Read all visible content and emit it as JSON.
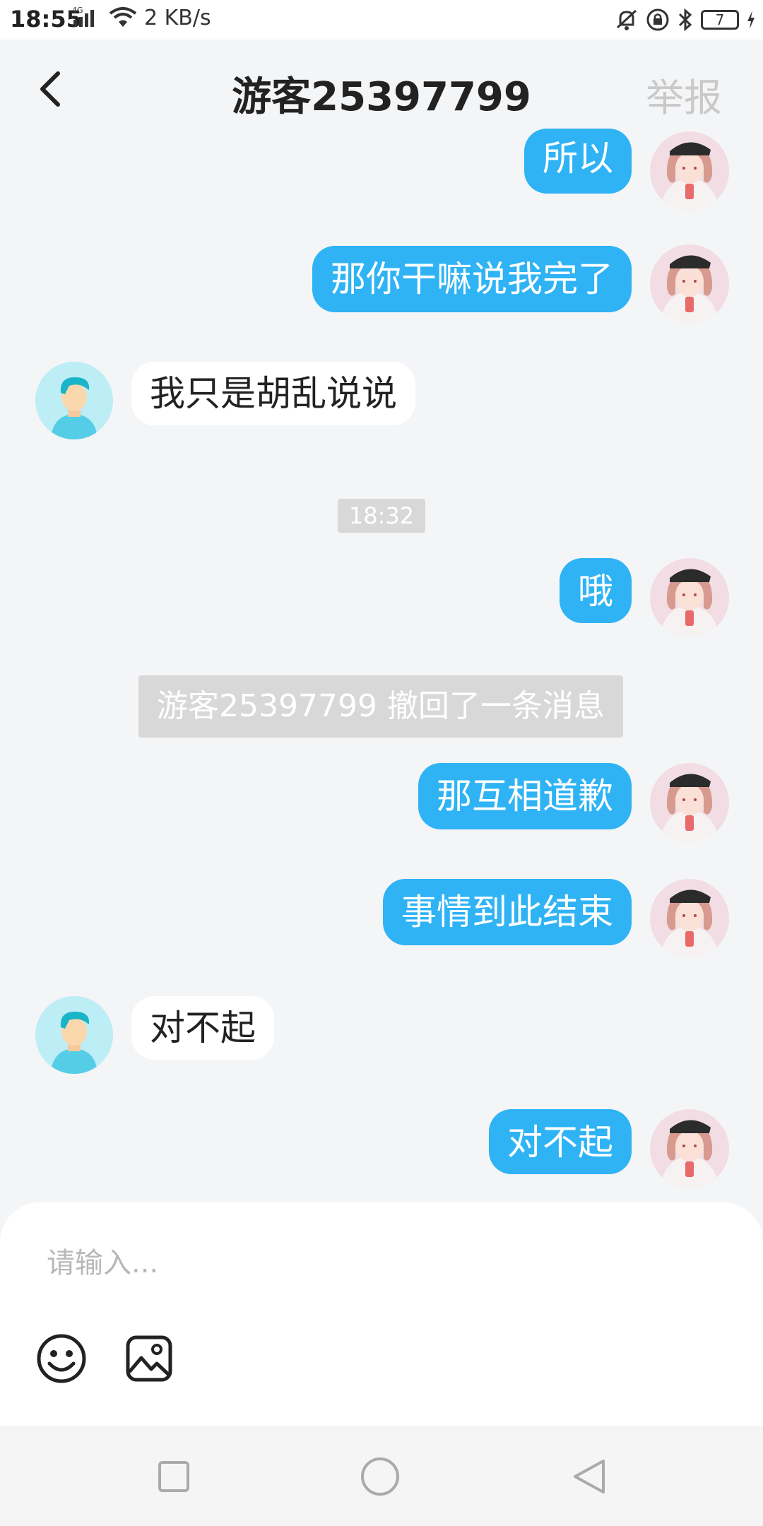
{
  "status_bar": {
    "time": "18:55",
    "network": "4G",
    "speed": "2 KB/s",
    "battery": "7"
  },
  "header": {
    "title": "游客25397799",
    "report_label": "举报"
  },
  "messages": [
    {
      "sender": "me",
      "text": "所以"
    },
    {
      "sender": "me",
      "text": "那你干嘛说我完了"
    },
    {
      "sender": "other",
      "text": "我只是胡乱说说"
    },
    {
      "type": "time",
      "text": "18:32"
    },
    {
      "sender": "me",
      "text": "哦"
    },
    {
      "type": "notice",
      "text": "游客25397799 撤回了一条消息"
    },
    {
      "sender": "me",
      "text": "那互相道歉"
    },
    {
      "sender": "me",
      "text": "事情到此结束"
    },
    {
      "sender": "other",
      "text": "对不起"
    },
    {
      "sender": "me",
      "text": "对不起"
    }
  ],
  "input": {
    "placeholder": "请输入...",
    "value": ""
  },
  "icons": {
    "emoji": "emoji-icon",
    "image": "image-icon",
    "back": "back-arrow-icon"
  },
  "colors": {
    "bubble_me": "#2fb3f5",
    "bubble_other": "#ffffff",
    "background": "#f4f5f7"
  }
}
